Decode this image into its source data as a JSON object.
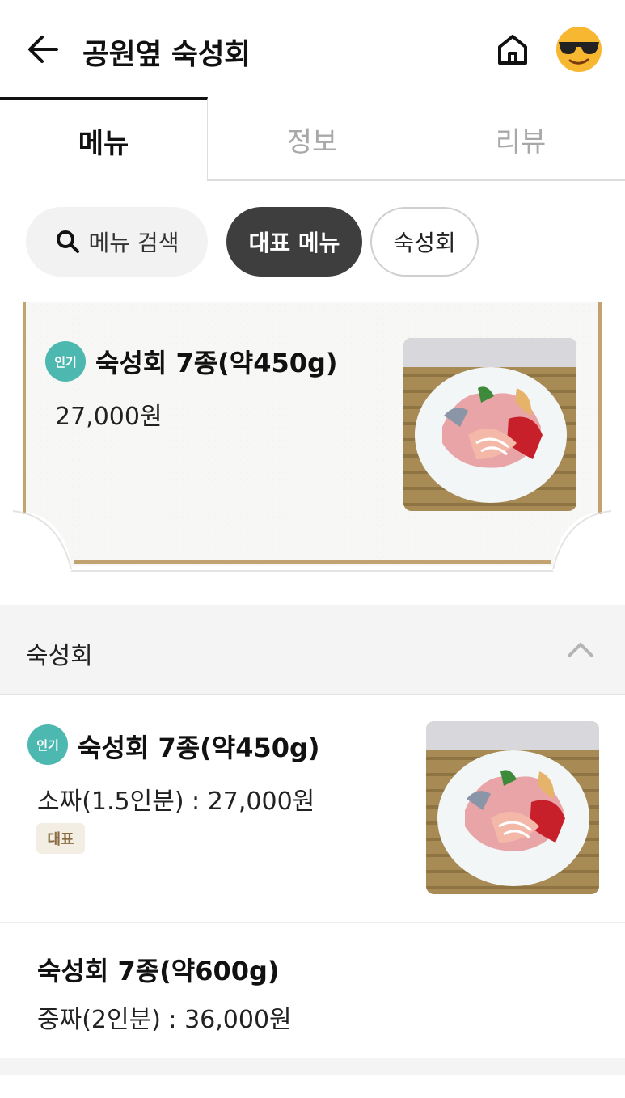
{
  "header": {
    "title": "공원옆 숙성회",
    "back_icon": "arrow-left-icon",
    "home_icon": "home-icon",
    "avatar_icon": "sunglasses-emoji-avatar"
  },
  "tabs": [
    {
      "label": "메뉴",
      "active": true
    },
    {
      "label": "정보",
      "active": false
    },
    {
      "label": "리뷰",
      "active": false
    }
  ],
  "chips": {
    "search_label": "메뉴 검색",
    "representative_label": "대표 메뉴",
    "category_label": "숙성회"
  },
  "featured": {
    "badge": "인기",
    "name": "숙성회 7종(약450g)",
    "price": "27,000원"
  },
  "section": {
    "title": "숙성회",
    "collapse_icon": "chevron-up-icon"
  },
  "items": [
    {
      "badge": "인기",
      "name": "숙성회 7종(약450g)",
      "price": "소짜(1.5인분) : 27,000원",
      "tag": "대표"
    },
    {
      "name": "숙성회 7종(약600g)",
      "price": "중짜(2인분) : 36,000원"
    }
  ],
  "colors": {
    "accent_dark": "#3e3e3e",
    "popular_badge": "#4cb8b0",
    "frame_gold": "#c2a271",
    "rep_tag_bg": "#f3eee4",
    "rep_tag_text": "#8a6a40"
  }
}
